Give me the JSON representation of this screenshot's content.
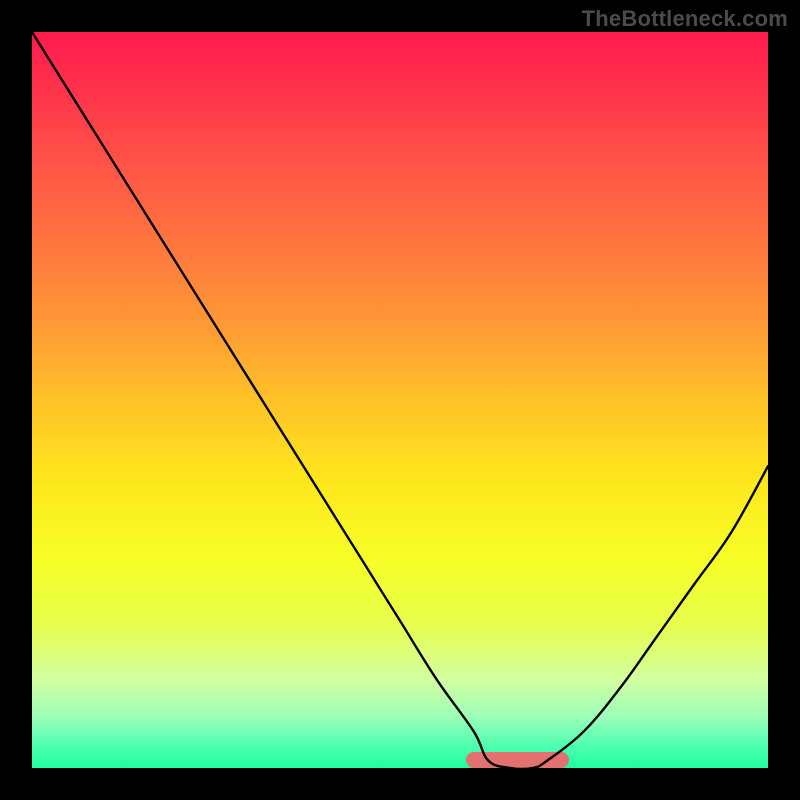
{
  "watermark": "TheBottleneck.com",
  "colors": {
    "background": "#000000",
    "curve": "#000000",
    "highlight": "#e27170",
    "gradient_top": "#ff1a4f",
    "gradient_bottom": "#1fff9c"
  },
  "chart_data": {
    "type": "line",
    "title": "",
    "xlabel": "",
    "ylabel": "",
    "xlim": [
      0,
      100
    ],
    "ylim": [
      0,
      100
    ],
    "grid": false,
    "legend": false,
    "series": [
      {
        "name": "bottleneck-curve",
        "x": [
          0,
          5,
          10,
          15,
          20,
          25,
          30,
          35,
          40,
          45,
          50,
          55,
          60,
          62,
          65,
          68,
          70,
          75,
          80,
          85,
          90,
          95,
          100
        ],
        "values": [
          100,
          92,
          84,
          76,
          68,
          60,
          52,
          44,
          36,
          28,
          20,
          12,
          5,
          1,
          0,
          0,
          1,
          5,
          11,
          18,
          25,
          32,
          41
        ]
      }
    ],
    "optimal_range_x": [
      59,
      73
    ],
    "annotations": []
  }
}
